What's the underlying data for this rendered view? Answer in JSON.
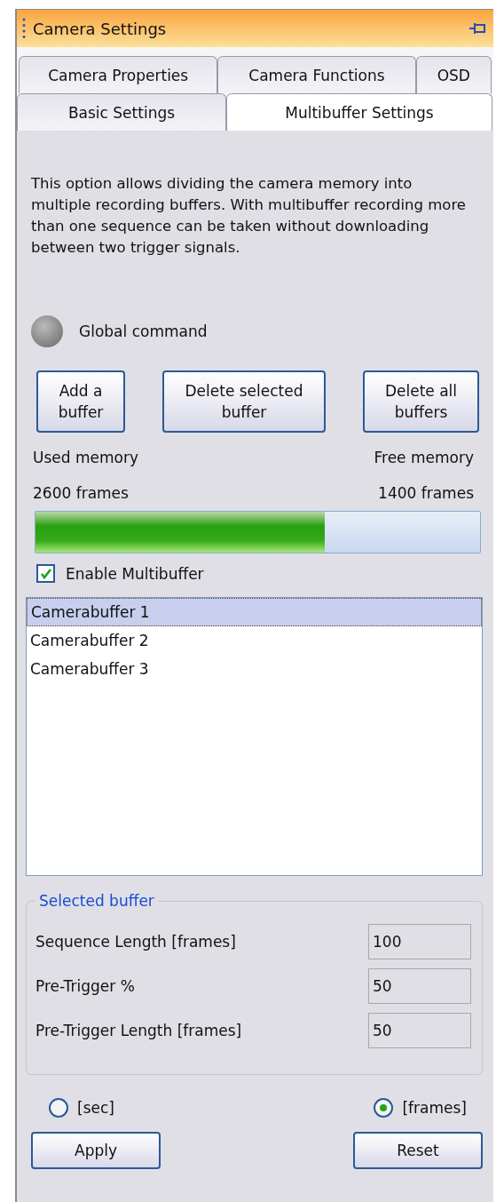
{
  "panel": {
    "title": "Camera Settings"
  },
  "tab_rows": [
    [
      {
        "label": "Camera Properties",
        "selected": false
      },
      {
        "label": "Camera Functions",
        "selected": false
      },
      {
        "label": "OSD",
        "selected": false
      }
    ],
    [
      {
        "label": "Basic Settings",
        "selected": false
      },
      {
        "label": "Multibuffer Settings",
        "selected": true
      }
    ]
  ],
  "description": "This option allows dividing the camera memory into multiple recording buffers. With multibuffer recording more than one sequence can be taken without downloading between two trigger signals.",
  "global_command": {
    "label": "Global command"
  },
  "buttons": [
    "Add a buffer",
    "Delete selected buffer",
    "Delete all buffers"
  ],
  "memory": {
    "used_label": "Used memory",
    "free_label": "Free memory",
    "used_value": "2600 frames",
    "free_value": "1400 frames",
    "level": 0.65
  },
  "enable_multibuffer": {
    "label": "Enable Multibuffer",
    "checked": true
  },
  "buffers": [
    {
      "label": "Camerabuffer 1",
      "selected": true
    },
    {
      "label": "Camerabuffer 2",
      "selected": false
    },
    {
      "label": "Camerabuffer 3",
      "selected": false
    }
  ],
  "selected_buffer": {
    "title": "Selected buffer",
    "fields": [
      {
        "label": "Sequence Length [frames]",
        "value": "100"
      },
      {
        "label": "Pre-Trigger %",
        "value": "50"
      },
      {
        "label": "Pre-Trigger Length [frames]",
        "value": "50"
      }
    ]
  },
  "units": [
    {
      "label": "[sec]",
      "selected": false
    },
    {
      "label": "[frames]",
      "selected": true
    }
  ],
  "footer_buttons": [
    "Apply",
    "Reset"
  ]
}
